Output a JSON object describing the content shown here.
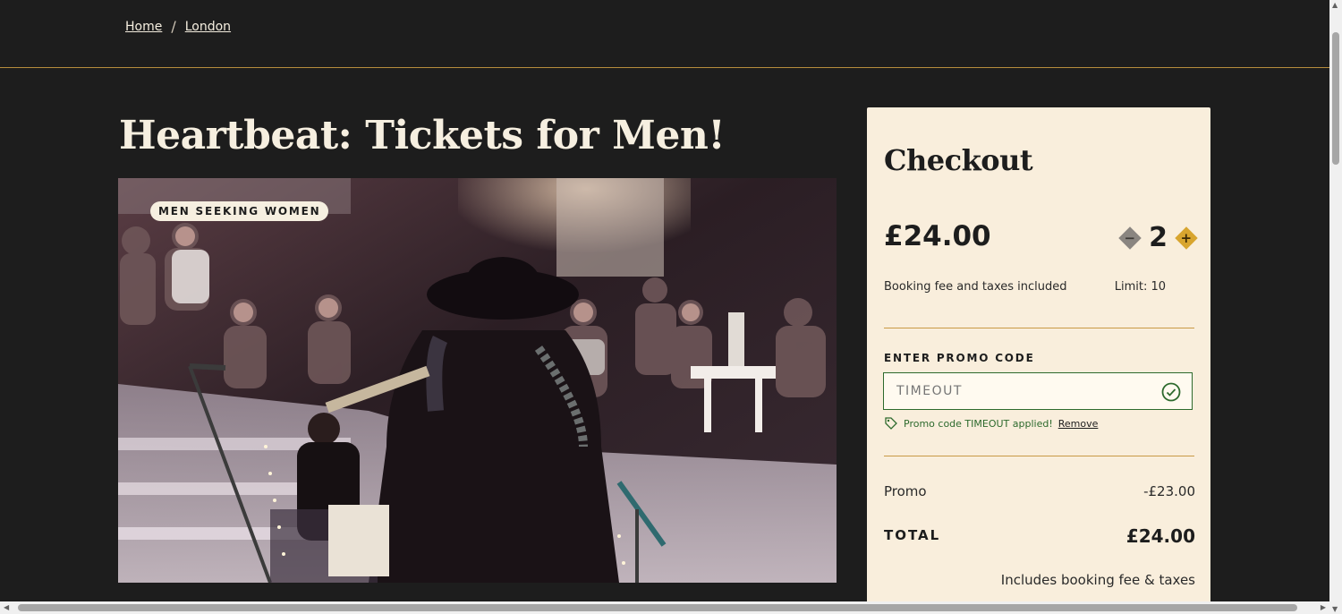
{
  "breadcrumb": {
    "home": "Home",
    "separator": "/",
    "city": "London"
  },
  "event": {
    "title": "Heartbeat: Tickets for Men!",
    "badge": "MEN SEEKING WOMEN",
    "image_alt": "Acoustic guitarist performing to a seated crowd"
  },
  "checkout": {
    "title": "Checkout",
    "price": "£24.00",
    "quantity": "2",
    "decrease_icon": "minus-icon",
    "increase_icon": "plus-icon",
    "fee_note": "Booking fee and taxes included",
    "limit": "Limit: 10",
    "promo_label": "ENTER PROMO CODE",
    "promo_placeholder": "TIMEOUT",
    "promo_applied_text": "Promo code TIMEOUT applied!",
    "promo_remove": "Remove",
    "promo_row_label": "Promo",
    "promo_row_value": "-£23.00",
    "total_label": "TOTAL",
    "total_value": "£24.00",
    "includes_note": "Includes booking fee & taxes"
  },
  "colors": {
    "background": "#1d1d1d",
    "panel": "#f9eedc",
    "accent_gold": "#d8a52f",
    "success_green": "#2d6a2d"
  }
}
